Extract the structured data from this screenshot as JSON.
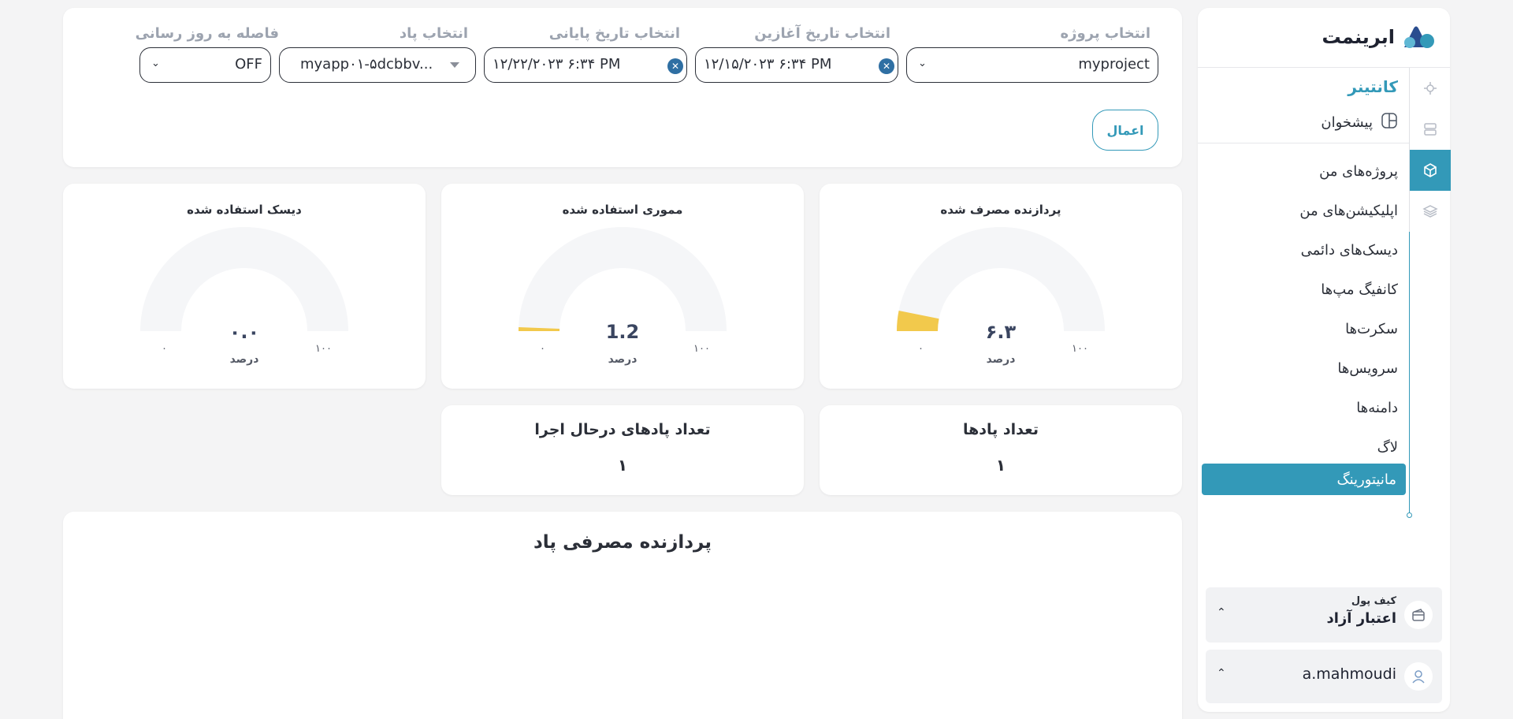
{
  "brand": {
    "name": "ابرینمت"
  },
  "sidebar": {
    "section_title": "کانتینر",
    "dashboard_label": "پیشخوان",
    "items": [
      {
        "label": "پروژه‌های من"
      },
      {
        "label": "اپلیکیشن‌های من"
      },
      {
        "label": "دیسک‌های دائمی"
      },
      {
        "label": "کانفیگ مپ‌ها"
      },
      {
        "label": "سکرت‌ها"
      },
      {
        "label": "سرویس‌ها"
      },
      {
        "label": "دامنه‌ها"
      },
      {
        "label": "لاگ"
      }
    ],
    "active_item": "مانیتورینگ",
    "wallet": {
      "title": "کیف پول",
      "value": "اعتبار آزاد"
    },
    "user": {
      "name": "a.mahmoudi"
    }
  },
  "filters": {
    "project": {
      "label": "انتخاب پروژه",
      "value": "myproject"
    },
    "start_date": {
      "label": "انتخاب تاریخ آغازین",
      "value": "۱۲/۱۵/۲۰۲۳ ۶:۳۴ PM"
    },
    "end_date": {
      "label": "انتخاب تاریخ پایانی",
      "value": "۱۲/۲۲/۲۰۲۳ ۶:۳۴ PM"
    },
    "pod": {
      "label": "انتخاب پاد",
      "value": "myapp۰۱-۵dcbbv..."
    },
    "refresh": {
      "label": "فاصله به روز رسانی",
      "value": "OFF"
    },
    "apply_label": "اعمال"
  },
  "gauges": [
    {
      "title": "پردازنده مصرف شده",
      "value": "۶.۳",
      "percent": 6.3,
      "unit": "درصد",
      "min": "۰",
      "max": "۱۰۰"
    },
    {
      "title": "مموری استفاده شده",
      "value": "1.2",
      "percent": 1.2,
      "unit": "درصد",
      "min": "۰",
      "max": "۱۰۰"
    },
    {
      "title": "دیسک استفاده شده",
      "value": "۰.۰",
      "percent": 0,
      "unit": "درصد",
      "min": "۰",
      "max": "۱۰۰"
    }
  ],
  "counts": [
    {
      "title": "تعداد پادها",
      "value": "۱"
    },
    {
      "title": "تعداد پادهای درحال اجرا",
      "value": "۱"
    }
  ],
  "cpu_chart": {
    "title": "پردازنده مصرفی پاد"
  },
  "colors": {
    "accent": "#3399b8",
    "gauge_fill": "#f2c94c",
    "gauge_track": "#f5f6f8"
  }
}
